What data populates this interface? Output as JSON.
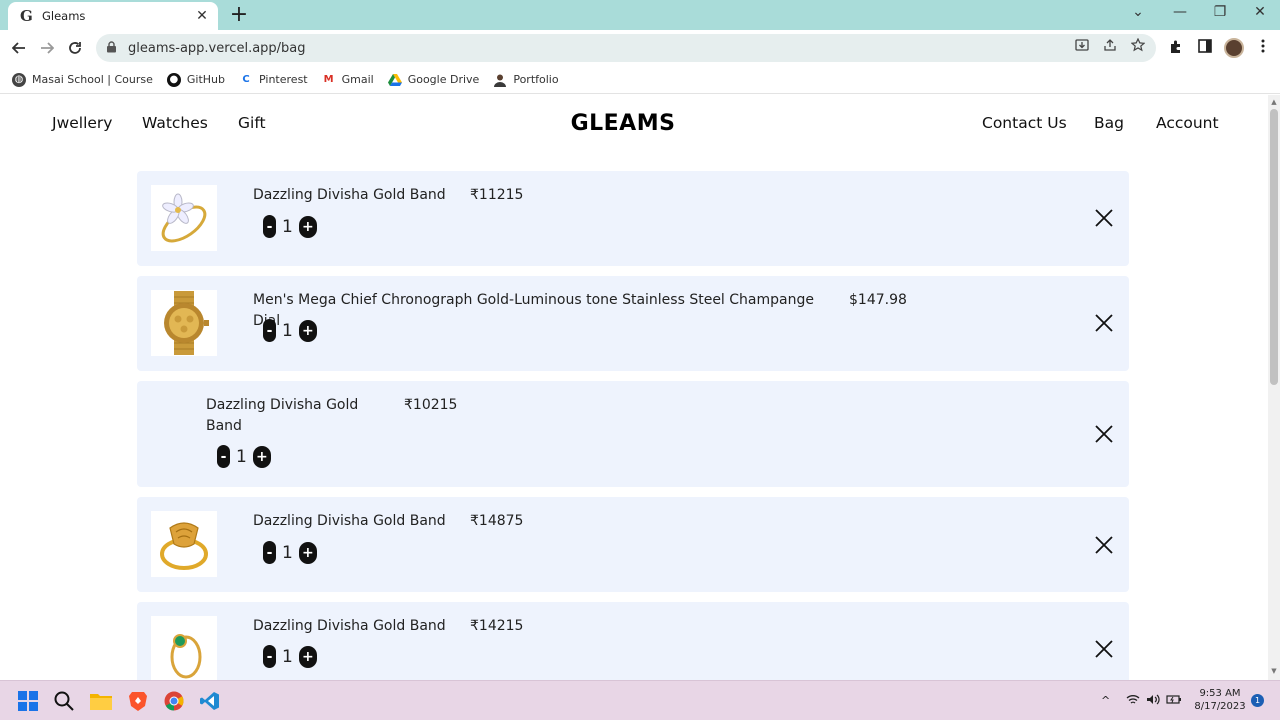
{
  "browser": {
    "tab": {
      "favicon": "G",
      "title": "Gleams",
      "close": "✕"
    },
    "new_tab": "+",
    "window_controls": {
      "tabsearch": "⌄",
      "minimize": "—",
      "restore": "❐",
      "close": "✕"
    },
    "url": "gleams-app.vercel.app/bag",
    "bookmarks": [
      {
        "label": "Masai School | Course",
        "icon": "globe-icon",
        "color": "#444444"
      },
      {
        "label": "GitHub",
        "icon": "github-icon",
        "color": "#111111"
      },
      {
        "label": "Pinterest",
        "icon": "pinterest-icon",
        "color": "#1a73e8"
      },
      {
        "label": "Gmail",
        "icon": "gmail-icon",
        "color": "#d93025"
      },
      {
        "label": "Google Drive",
        "icon": "drive-icon",
        "color": "#1e8e3e"
      },
      {
        "label": "Portfolio",
        "icon": "portfolio-icon",
        "color": "#5a4030"
      }
    ]
  },
  "site": {
    "brand": "GLEAMS",
    "nav_left": [
      "Jwellery",
      "Watches",
      "Gift"
    ],
    "nav_right": [
      "Contact Us",
      "Bag",
      "Account"
    ]
  },
  "bag": {
    "items": [
      {
        "name": "Dazzling Divisha Gold Band",
        "price": "₹11215",
        "quantity": "1",
        "image": "ring-flower-icon"
      },
      {
        "name": "Men's Mega Chief Chronograph Gold-Luminous tone Stainless Steel Champange Dial",
        "price": "$147.98",
        "quantity": "1",
        "image": "gold-watch-icon"
      },
      {
        "name": "Dazzling Divisha Gold Band",
        "price": "₹10215",
        "quantity": "1",
        "image": ""
      },
      {
        "name": "Dazzling Divisha Gold Band",
        "price": "₹14875",
        "quantity": "1",
        "image": "ring-ornate-icon"
      },
      {
        "name": "Dazzling Divisha Gold Band",
        "price": "₹14215",
        "quantity": "1",
        "image": "ring-emerald-icon"
      }
    ],
    "decrement_label": "-",
    "increment_label": "+"
  },
  "taskbar": {
    "time": "9:53 AM",
    "date": "8/17/2023",
    "notifications": "1",
    "tray_chevron": "^"
  },
  "colors": {
    "card_bg": "#eef3fd",
    "tabstrip": "#a9dcd9",
    "taskbar": "#e8d6e6"
  }
}
